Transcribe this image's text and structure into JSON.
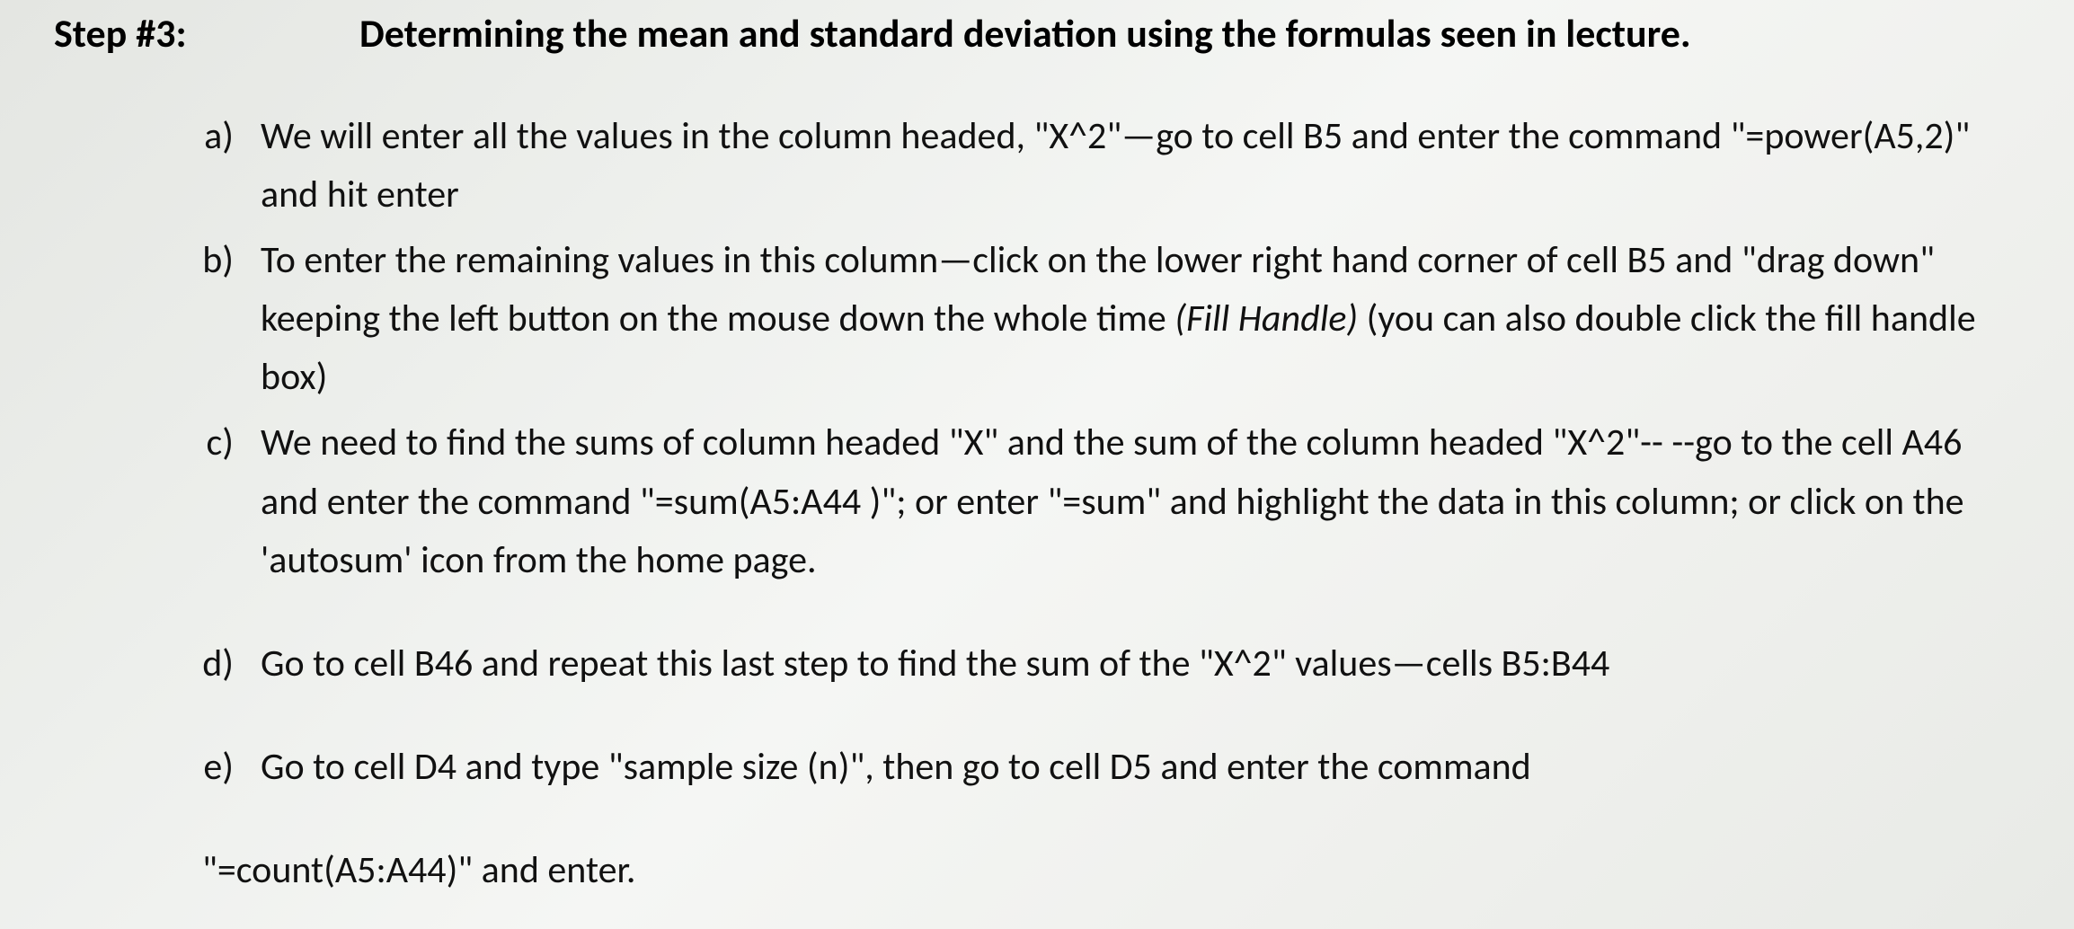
{
  "step": {
    "label": "Step #3:",
    "title": "Determining the mean and standard deviation using the formulas seen in lecture."
  },
  "items": {
    "a": {
      "marker": "a)",
      "text_1": "We will enter all the values in the column headed, \"X^2\"—go to cell B5 and enter the command \"=power(A5,2)\" and hit enter"
    },
    "b": {
      "marker": "b)",
      "text_1": "To enter the remaining values in this column—click on the lower right hand corner of cell B5 and \"drag down\" keeping the left button on the mouse down the whole time ",
      "italic": "(Fill Handle)",
      "text_2": " (you can also double click the fill handle box)"
    },
    "c": {
      "marker": "c)",
      "text_1": "We need to find the sums of column headed \"X\" and the sum of the column headed \"X^2\"-- --go to the cell A46 and enter the command \"=sum(A5:A44 )\"; or enter \"=sum\" and highlight the data in this column; or click on the 'autosum' icon from the home page."
    },
    "d": {
      "marker": "d)",
      "text_1": "Go to cell B46 and repeat this last step to find the sum of the \"X^2\" values—cells B5:B44"
    },
    "e": {
      "marker": "e)",
      "text_1": "Go to cell D4 and type \"sample size (n)\", then go to cell D5 and enter the command"
    }
  },
  "last_line": "\"=count(A5:A44)\" and enter."
}
